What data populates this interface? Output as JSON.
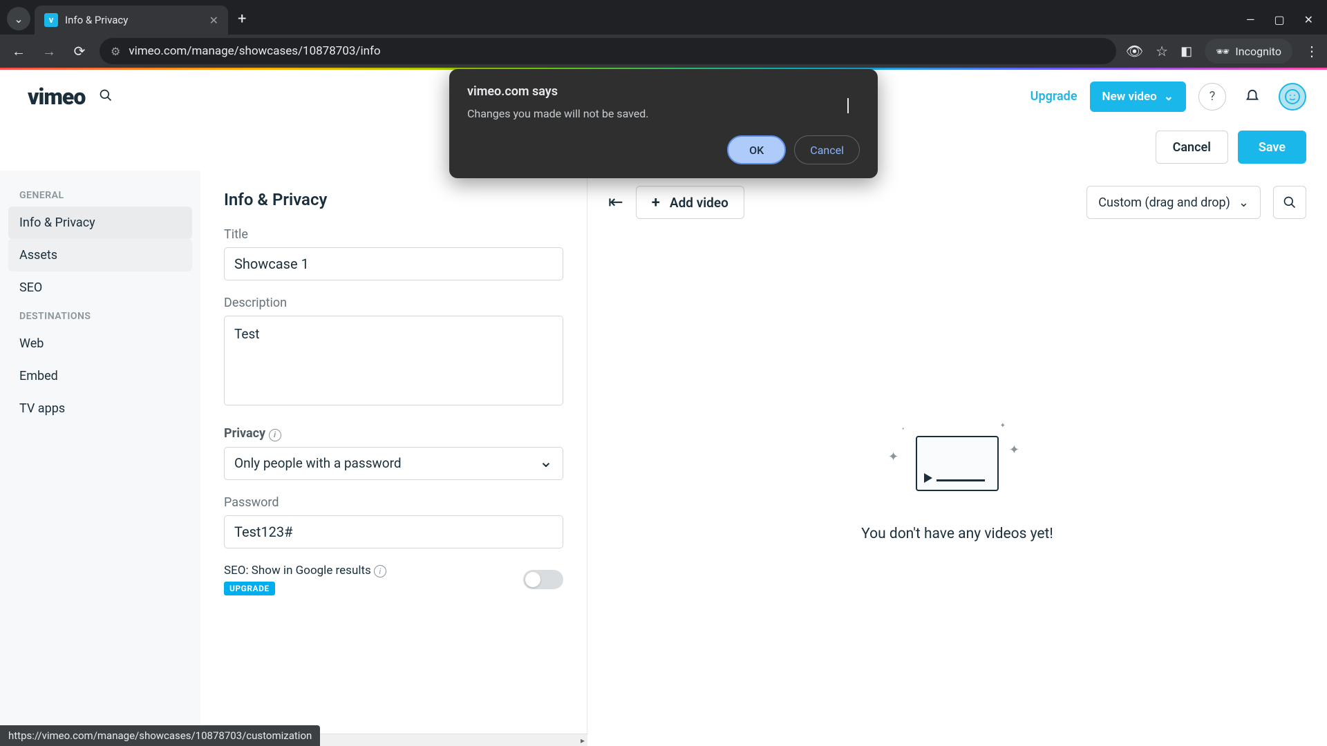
{
  "browser": {
    "tab_title": "Info & Privacy",
    "url": "vimeo.com/manage/showcases/10878703/info",
    "incognito_label": "Incognito",
    "status_url": "https://vimeo.com/manage/showcases/10878703/customization"
  },
  "dialog": {
    "host": "vimeo.com says",
    "message": "Changes you made will not be saved.",
    "ok": "OK",
    "cancel": "Cancel"
  },
  "header": {
    "logo": "vimeo",
    "upgrade": "Upgrade",
    "new_video": "New video"
  },
  "actions": {
    "cancel": "Cancel",
    "save": "Save"
  },
  "sidebar": {
    "section_general": "GENERAL",
    "section_destinations": "DESTINATIONS",
    "items": {
      "info_privacy": "Info & Privacy",
      "assets": "Assets",
      "seo": "SEO",
      "web": "Web",
      "embed": "Embed",
      "tv_apps": "TV apps"
    }
  },
  "form": {
    "heading": "Info & Privacy",
    "title_label": "Title",
    "title_value": "Showcase 1",
    "description_label": "Description",
    "description_value": "Test",
    "privacy_label": "Privacy",
    "privacy_value": "Only people with a password",
    "password_label": "Password",
    "password_value": "Test123#",
    "seo_label": "SEO: Show in Google results",
    "upgrade_badge": "UPGRADE"
  },
  "videos": {
    "add_video": "Add video",
    "sort_label": "Custom (drag and drop)",
    "empty_message": "You don't have any videos yet!"
  }
}
